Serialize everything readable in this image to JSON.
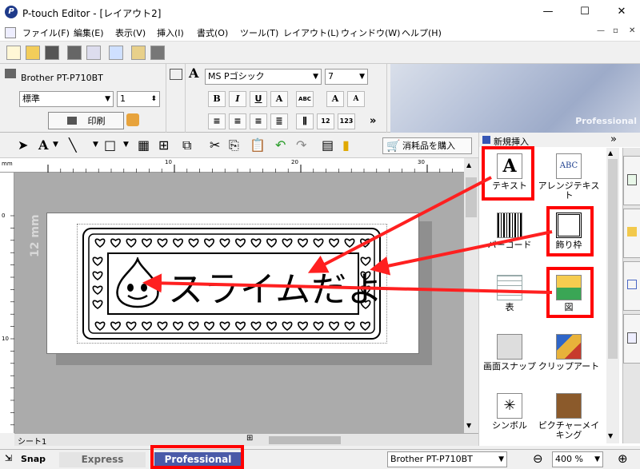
{
  "window": {
    "title": "P-touch Editor - [レイアウト2]",
    "minimize": "—",
    "maximize": "☐",
    "close": "✕"
  },
  "menu": [
    "ファイル(F)",
    "編集(E)",
    "表示(V)",
    "挿入(I)",
    "書式(O)",
    "ツール(T)",
    "レイアウト(L)",
    "ウィンドウ(W)",
    "ヘルプ(H)"
  ],
  "mdi": {
    "min": "—",
    "restore": "▫",
    "close": "✕"
  },
  "printer": {
    "name": "Brother PT-P710BT",
    "mode": "標準",
    "copies": "1",
    "print_label": "印刷"
  },
  "font": {
    "name": "MS Pゴシック",
    "size": "7"
  },
  "banner": "Professional",
  "buy_button": "消耗品を購入",
  "panel": {
    "title": "新規挿入",
    "expand": "»",
    "tools": [
      {
        "label": "テキスト",
        "icon": "text-icon"
      },
      {
        "label": "アレンジテキスト",
        "icon": "arrange-text-icon"
      },
      {
        "label": "バーコード",
        "icon": "barcode-icon"
      },
      {
        "label": "飾り枠",
        "icon": "frame-icon"
      },
      {
        "label": "表",
        "icon": "table-icon"
      },
      {
        "label": "図",
        "icon": "image-icon"
      },
      {
        "label": "画面スナップ",
        "icon": "screen-snap-icon"
      },
      {
        "label": "クリップアート",
        "icon": "clipart-icon"
      },
      {
        "label": "シンボル",
        "icon": "symbol-icon"
      },
      {
        "label": "ピクチャーメイキング",
        "icon": "picture-making-icon"
      }
    ]
  },
  "ruler": {
    "unit": "mm",
    "marks": [
      "10",
      "20",
      "30"
    ],
    "left_marks": [
      "0",
      "10"
    ]
  },
  "label": {
    "text": "スライムだよ",
    "size_label": "12 mm"
  },
  "sheet_tab": "シート1",
  "status": {
    "snap": "Snap",
    "express": "Express",
    "professional": "Professional",
    "printer": "Brother PT-P710BT",
    "zoom": "400 %"
  },
  "colors": {
    "highlight": "#ff0000",
    "arrow": "#ff2020",
    "professional_tab": "#4a5aa8"
  }
}
